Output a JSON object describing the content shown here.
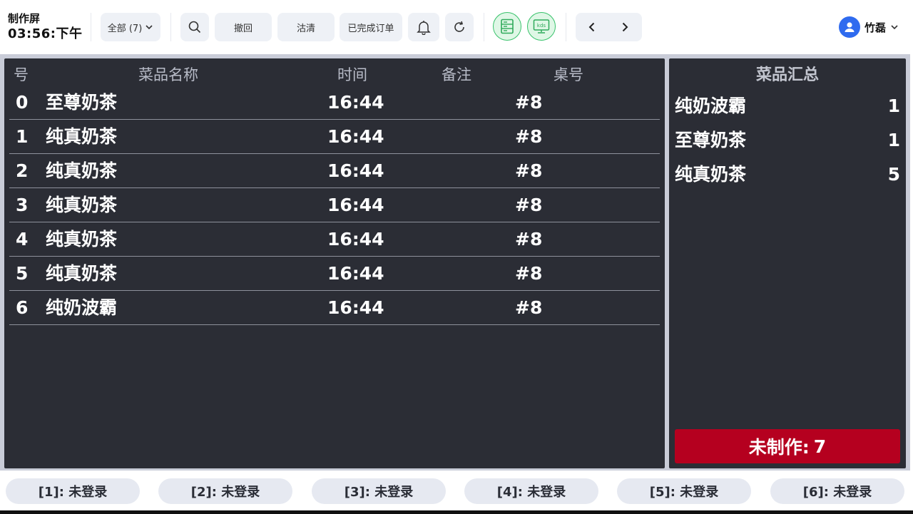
{
  "header": {
    "title": "制作屏",
    "time": "03:56:下午",
    "filter_label": "全部 (7)",
    "undo_label": "撤回",
    "clear_label": "沽清",
    "completed_label": "已完成订单",
    "user_name": "竹磊"
  },
  "table": {
    "columns": {
      "no": "号",
      "name": "菜品名称",
      "time": "时间",
      "note": "备注",
      "table": "桌号"
    },
    "rows": [
      {
        "no": "0",
        "name": "至尊奶茶",
        "time": "16:44",
        "note": "",
        "table": "#8"
      },
      {
        "no": "1",
        "name": "纯真奶茶",
        "time": "16:44",
        "note": "",
        "table": "#8"
      },
      {
        "no": "2",
        "name": "纯真奶茶",
        "time": "16:44",
        "note": "",
        "table": "#8"
      },
      {
        "no": "3",
        "name": "纯真奶茶",
        "time": "16:44",
        "note": "",
        "table": "#8"
      },
      {
        "no": "4",
        "name": "纯真奶茶",
        "time": "16:44",
        "note": "",
        "table": "#8"
      },
      {
        "no": "5",
        "name": "纯真奶茶",
        "time": "16:44",
        "note": "",
        "table": "#8"
      },
      {
        "no": "6",
        "name": "纯奶波霸",
        "time": "16:44",
        "note": "",
        "table": "#8"
      }
    ]
  },
  "summary": {
    "title": "菜品汇总",
    "items": [
      {
        "name": "纯奶波霸",
        "qty": "1"
      },
      {
        "name": "至尊奶茶",
        "qty": "1"
      },
      {
        "name": "纯真奶茶",
        "qty": "5"
      }
    ],
    "pending_label": "未制作:",
    "pending_count": "7"
  },
  "stations": [
    {
      "label": "[1]: 未登录"
    },
    {
      "label": "[2]: 未登录"
    },
    {
      "label": "[3]: 未登录"
    },
    {
      "label": "[4]: 未登录"
    },
    {
      "label": "[5]: 未登录"
    },
    {
      "label": "[6]: 未登录"
    }
  ],
  "colors": {
    "panel": "#2b2d35",
    "accent_green": "#37c26a",
    "pending_red": "#b5001f",
    "avatar_blue": "#2f6bef"
  },
  "icons": {
    "search": "search-icon",
    "bell": "bell-icon",
    "refresh": "refresh-icon",
    "server": "server-icon",
    "kds": "kds-icon",
    "prev": "chevron-left-icon",
    "next": "chevron-right-icon",
    "user": "user-icon"
  }
}
